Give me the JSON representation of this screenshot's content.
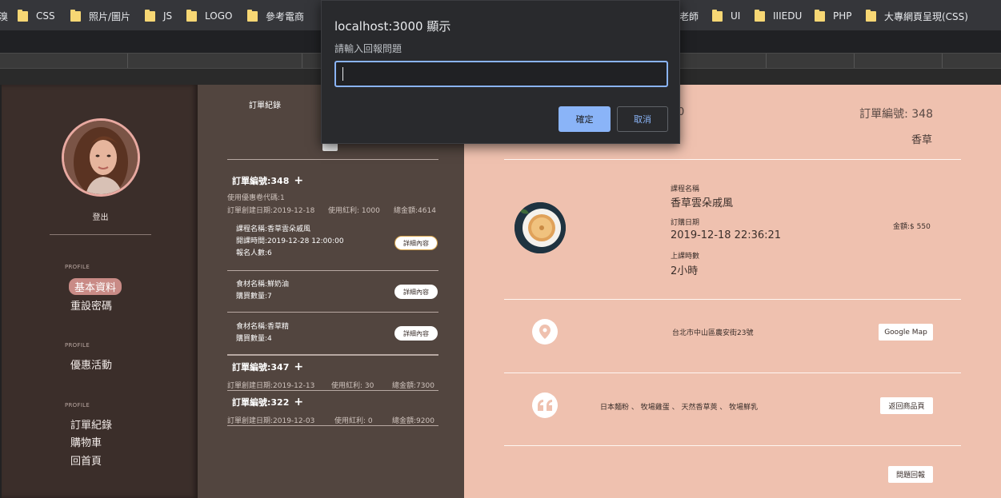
{
  "bookmarks": [
    {
      "label": "溴"
    },
    {
      "label": "CSS"
    },
    {
      "label": "照片/圖片"
    },
    {
      "label": "JS"
    },
    {
      "label": "LOGO"
    },
    {
      "label": "參考電商"
    },
    {
      "label": "老師"
    },
    {
      "label": "UI"
    },
    {
      "label": "IIIEDU"
    },
    {
      "label": "PHP"
    },
    {
      "label": "大專網頁呈現(CSS)"
    }
  ],
  "sidebar": {
    "logout": "登出",
    "sections": [
      {
        "label": "PROFILE",
        "items": [
          "基本資料",
          "重設密碼"
        ]
      },
      {
        "label": "PROFILE",
        "items": [
          "優惠活動"
        ]
      },
      {
        "label": "PROFILE",
        "items": [
          "訂單紀錄",
          "購物車",
          "回首頁"
        ]
      }
    ]
  },
  "orders_panel": {
    "title": "訂單紀錄",
    "orders": [
      {
        "head": "訂單編號:348",
        "coupon": "使用優惠卷代碼:1",
        "meta_date": "訂單創建日期:2019-12-18",
        "meta_bonus": "使用紅利: 1000",
        "meta_total": "總金額:4614",
        "items": [
          {
            "line1": "課程名稱:香草雲朵戚風",
            "line2": "開課時間:2019-12-28 12:00:00",
            "line3": "報名人數:6",
            "button": "詳細內容"
          },
          {
            "line1": "食材名稱:鮮奶油",
            "line2": "購買數量:7",
            "button": "詳細內容"
          },
          {
            "line1": "食材名稱:香草精",
            "line2": "購買數量:4",
            "button": "詳細內容"
          }
        ]
      },
      {
        "head": "訂單編號:347",
        "meta_date": "訂單創建日期:2019-12-13",
        "meta_bonus": "使用紅利: 30",
        "meta_total": "總金額:7300"
      },
      {
        "head": "訂單編號:322",
        "meta_date": "訂單創建日期:2019-12-03",
        "meta_bonus": "使用紅利: 0",
        "meta_total": "總金額:9200"
      }
    ]
  },
  "detail": {
    "partial_number": "0",
    "order_no": "訂單編號: 348",
    "category": "香草",
    "course_label": "課程名稱",
    "course_value": "香草雲朵戚風",
    "order_date_label": "訂購日期",
    "order_date_value": "2019-12-18 22:36:21",
    "hours_label": "上課時數",
    "hours_value": "2小時",
    "price": "金額:$ 550",
    "address": "台北市中山區農安街23號",
    "map_button": "Google Map",
    "ingredients": "日本麵粉 、 牧場雞蛋 、 天然香草莢 、 牧場鮮乳",
    "back_button": "返回商品頁",
    "report_button": "問題回報"
  },
  "dialog": {
    "title": "localhost:3000 顯示",
    "message": "請輸入回報問題",
    "input_value": "",
    "ok": "確定",
    "cancel": "取消"
  }
}
